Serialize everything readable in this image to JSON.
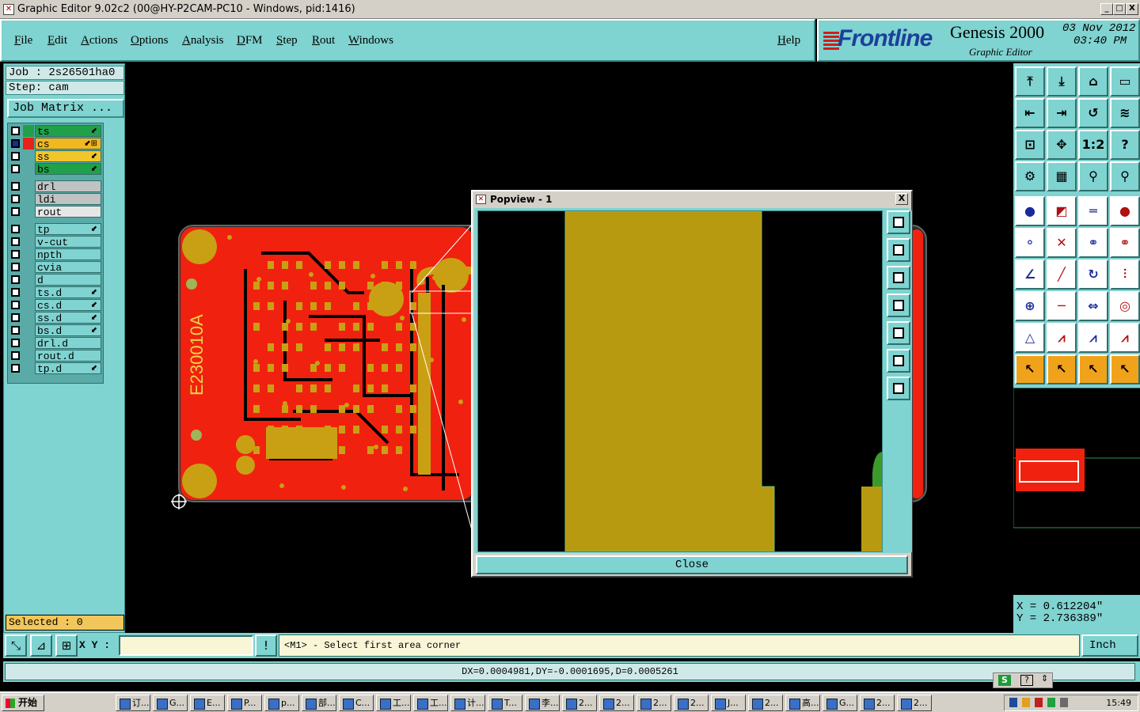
{
  "window": {
    "title": "Graphic Editor 9.02c2 (00@HY-P2CAM-PC10 - Windows, pid:1416)",
    "minimize": "_",
    "maximize": "□",
    "close": "X"
  },
  "menu": {
    "items": [
      "File",
      "Edit",
      "Actions",
      "Options",
      "Analysis",
      "DFM",
      "Step",
      "Rout",
      "Windows"
    ],
    "help": "Help"
  },
  "brand": {
    "logo": "Frontline",
    "product": "Genesis 2000",
    "subtitle": "Graphic Editor",
    "date": "03 Nov 2012",
    "time": "03:40 PM"
  },
  "job": {
    "job_line": "Job : 2s26501ha0",
    "step_line": "Step: cam",
    "matrix_button": "Job Matrix ..."
  },
  "layers": [
    {
      "name": "ts",
      "color": "#21a04a",
      "bg": "#21a04a",
      "mark": "⬋"
    },
    {
      "name": "cs",
      "color": "#e8221b",
      "bg": "#f1b81f",
      "mark": "⬋⊞",
      "active": true
    },
    {
      "name": "ss",
      "color": "#5aaaa7",
      "bg": "#f1c62a",
      "mark": "⬋"
    },
    {
      "name": "bs",
      "color": "#5aaaa7",
      "bg": "#21a04a",
      "mark": "⬋"
    },
    {
      "name": "drl",
      "color": "#5aaaa7",
      "bg": "#bfc3c2",
      "mark": ""
    },
    {
      "name": "ldi",
      "color": "#5aaaa7",
      "bg": "#bfc3c2",
      "mark": ""
    },
    {
      "name": "rout",
      "color": "#5aaaa7",
      "bg": "#e6e6e6",
      "mark": ""
    },
    {
      "name": "tp",
      "color": "#5aaaa7",
      "bg": "#7fd3d0",
      "mark": "⬋"
    },
    {
      "name": "v-cut",
      "color": "#5aaaa7",
      "bg": "#7fd3d0",
      "mark": ""
    },
    {
      "name": "npth",
      "color": "#5aaaa7",
      "bg": "#7fd3d0",
      "mark": ""
    },
    {
      "name": "cvia",
      "color": "#5aaaa7",
      "bg": "#7fd3d0",
      "mark": ""
    },
    {
      "name": "d",
      "color": "#5aaaa7",
      "bg": "#7fd3d0",
      "mark": ""
    },
    {
      "name": "ts.d",
      "color": "#5aaaa7",
      "bg": "#7fd3d0",
      "mark": "⬋"
    },
    {
      "name": "cs.d",
      "color": "#5aaaa7",
      "bg": "#7fd3d0",
      "mark": "⬋"
    },
    {
      "name": "ss.d",
      "color": "#5aaaa7",
      "bg": "#7fd3d0",
      "mark": "⬋"
    },
    {
      "name": "bs.d",
      "color": "#5aaaa7",
      "bg": "#7fd3d0",
      "mark": "⬋"
    },
    {
      "name": "drl.d",
      "color": "#5aaaa7",
      "bg": "#7fd3d0",
      "mark": ""
    },
    {
      "name": "rout.d",
      "color": "#5aaaa7",
      "bg": "#7fd3d0",
      "mark": ""
    },
    {
      "name": "tp.d",
      "color": "#5aaaa7",
      "bg": "#7fd3d0",
      "mark": "⬋"
    }
  ],
  "selected": "Selected : 0",
  "board": {
    "label": "E230010A",
    "copper_color": "#f1210f",
    "pad_color": "#c9a014"
  },
  "popview": {
    "title": "Popview - 1",
    "close_x": "X",
    "close_button": "Close",
    "copper_color": "#b89a10"
  },
  "coords": {
    "x": "X = 0.612204\"",
    "y": "Y = 2.736389\""
  },
  "command": {
    "xy_label": "X Y :",
    "xy_value": "",
    "prompt": "<M1> - Select first area corner",
    "units": "Inch"
  },
  "status": {
    "message": "DX=0.0004981,DY=-0.0001695,D=0.0005261"
  },
  "taskbar": {
    "start": "开始",
    "items": [
      "订...",
      "G...",
      "E...",
      "P...",
      "p...",
      "部...",
      "C...",
      "工...",
      "工...",
      "计...",
      "T...",
      "李...",
      "2...",
      "2...",
      "2...",
      "2...",
      "J...",
      "2...",
      "高...",
      "G...",
      "2...",
      "2..."
    ],
    "clock": "15:49"
  }
}
